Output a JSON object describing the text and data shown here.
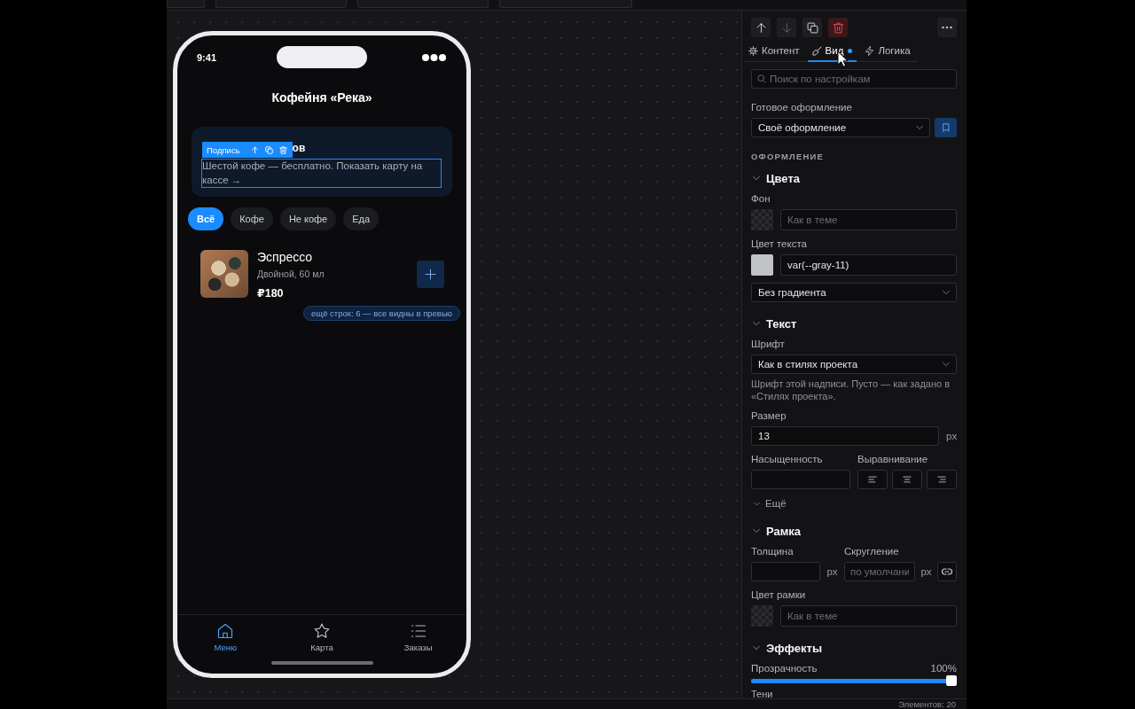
{
  "phone": {
    "time": "9:41",
    "title": "Кофейня «Река»",
    "promo_card": {
      "heading": "ов",
      "text": "Шестой кофе — бесплатно. Показать карту на кассе →",
      "selected": true
    },
    "selection_toolbar": {
      "label": "Подпись"
    },
    "filters": [
      {
        "label": "Всё",
        "selected": true
      },
      {
        "label": "Кофе",
        "selected": false
      },
      {
        "label": "Не кофе",
        "selected": false
      },
      {
        "label": "Еда",
        "selected": false
      }
    ],
    "items": [
      {
        "name": "Эспрессо",
        "description": "Двойной, 60 мл",
        "price": "₽180"
      }
    ],
    "more_rows_badge": "ещё строк: 6 — все видны в превью",
    "tab_bar": [
      {
        "kind": "menu",
        "label": "Меню",
        "selected": true
      },
      {
        "kind": "loyalty",
        "label": "Карта",
        "selected": false
      },
      {
        "kind": "orders",
        "label": "Заказы",
        "selected": false
      }
    ]
  },
  "inspector": {
    "actions": [
      {
        "kind": "move_up",
        "disabled": false
      },
      {
        "kind": "move_down",
        "disabled": true
      },
      {
        "kind": "duplicate",
        "disabled": false
      },
      {
        "kind": "delete",
        "disabled": false
      }
    ],
    "tabs": [
      {
        "kind": "content",
        "label": "Контент",
        "selected": false,
        "modified": false
      },
      {
        "kind": "style",
        "label": "Вид",
        "selected": true,
        "modified": true
      },
      {
        "kind": "logic",
        "label": "Логика",
        "selected": false,
        "modified": false
      }
    ],
    "search": {
      "placeholder": "Поиск по настройкам"
    },
    "preset": {
      "label": "Готовое оформление",
      "value": "Своё оформление"
    },
    "section_heading": "ОФОРМЛЕНИЕ",
    "groups": [
      {
        "title": "Цвета",
        "expanded": true,
        "rows": [
          {
            "kind": "color",
            "label": "Фон",
            "placeholder": "Как в теме"
          },
          {
            "kind": "color",
            "label": "Цвет текста",
            "value": "var(--gray-11)",
            "color": "#c2c3c7"
          },
          {
            "kind": "select",
            "value": "Без градиента"
          }
        ]
      },
      {
        "title": "Текст",
        "expanded": true,
        "rows": [
          {
            "kind": "select",
            "label": "Шрифт",
            "value": "Как в стилях проекта"
          },
          {
            "kind": "hint",
            "text": "Шрифт этой надписи. Пусто — как задано в «Стилях проекта»."
          },
          {
            "kind": "number",
            "label": "Размер",
            "value": "13",
            "unit": "px"
          },
          {
            "kind": "weight_align",
            "weight_label": "Насыщенность",
            "align_label": "Выравнивание",
            "align_options": [
              {
                "kind": "left",
                "selected": false
              },
              {
                "kind": "center",
                "selected": false
              },
              {
                "kind": "right",
                "selected": false
              }
            ]
          },
          {
            "kind": "toggle",
            "label": "Ещё"
          }
        ]
      },
      {
        "title": "Рамка",
        "expanded": true,
        "rows": [
          {
            "kind": "border",
            "width_label": "Толщина",
            "width_unit": "px",
            "radius_label": "Скругление",
            "radius_placeholder": "по умолчани",
            "radius_unit": "px"
          },
          {
            "kind": "color",
            "label": "Цвет рамки",
            "placeholder": "Как в теме"
          }
        ]
      },
      {
        "title": "Эффекты",
        "expanded": true,
        "rows": [
          {
            "kind": "slider",
            "label": "Прозрачность",
            "reading": "100%",
            "level": 1
          },
          {
            "kind": "label",
            "label": "Тени"
          }
        ]
      }
    ]
  },
  "status_bar": {
    "element_count": "Элементов: 20"
  }
}
